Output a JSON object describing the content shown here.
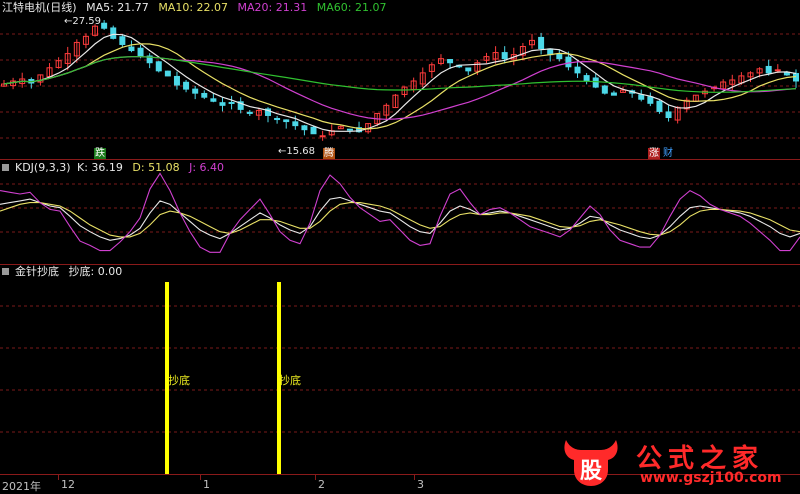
{
  "price_panel": {
    "title": "江特电机(日线)",
    "ma": [
      {
        "label": "MA5: 21.77",
        "color": "#e8e8e8"
      },
      {
        "label": "MA10: 22.07",
        "color": "#e8e066"
      },
      {
        "label": "MA20: 21.31",
        "color": "#d040d0"
      },
      {
        "label": "MA60: 21.07",
        "color": "#30c030"
      }
    ],
    "high_label": "27.59",
    "low_label": "15.68",
    "markers": [
      {
        "text": "跌",
        "bg": "#1a7a1a",
        "color": "#ffffff"
      },
      {
        "text": "腾",
        "bg": "#b05010",
        "color": "#ffffff"
      },
      {
        "text": "涨",
        "bg": "#b02020",
        "color": "#ffffff"
      },
      {
        "text": "财",
        "bg": "#000000",
        "color": "#40a0ff"
      }
    ]
  },
  "kdj_panel": {
    "name": "KDJ(9,3,3)",
    "k": "K: 36.19",
    "d": "D: 51.08",
    "j": "J: 6.40",
    "colors": {
      "k": "#e8e8e8",
      "d": "#e8e066",
      "j": "#d040d0"
    }
  },
  "signal_panel": {
    "name": "金针抄底",
    "value": "抄底: 0.00",
    "signal_label": "抄底",
    "signal_color": "#ffff00"
  },
  "time_axis": {
    "labels": [
      "2021年",
      "12",
      "1",
      "2",
      "3"
    ]
  },
  "watermark": {
    "title": "公式之家",
    "url": "www.gszj100.com",
    "logo_text": "股"
  },
  "chart_data": [
    {
      "type": "candlestick",
      "ylim": [
        15.68,
        27.59
      ],
      "annotations": [
        "27.59",
        "15.68"
      ],
      "close": [
        21.5,
        21.8,
        22.0,
        21.6,
        22.4,
        23.1,
        23.8,
        24.5,
        25.6,
        26.2,
        27.2,
        27.0,
        26.0,
        25.4,
        24.8,
        24.2,
        23.6,
        22.8,
        22.3,
        21.4,
        21.0,
        20.6,
        20.2,
        19.8,
        19.4,
        19.6,
        19.0,
        18.6,
        18.9,
        18.4,
        18.0,
        17.8,
        17.4,
        17.0,
        16.6,
        16.4,
        16.9,
        17.3,
        17.0,
        16.8,
        17.6,
        18.6,
        19.4,
        20.4,
        21.2,
        21.8,
        22.6,
        23.4,
        24.0,
        23.6,
        23.2,
        22.8,
        23.6,
        24.2,
        24.6,
        24.0,
        24.4,
        25.2,
        25.8,
        25.0,
        24.4,
        24.0,
        23.2,
        22.6,
        21.8,
        21.2,
        20.6,
        20.4,
        20.9,
        20.6,
        20.0,
        19.6,
        18.8,
        18.2,
        19.2,
        19.9,
        20.4,
        20.8,
        21.2,
        21.7,
        21.9,
        22.3,
        22.6,
        23.0,
        22.6,
        22.9,
        22.4,
        21.8
      ]
    },
    {
      "type": "line",
      "series": [
        {
          "name": "K",
          "values": [
            70,
            72,
            74,
            76,
            72,
            68,
            66,
            56,
            45,
            38,
            32,
            28,
            30,
            34,
            42,
            60,
            74,
            70,
            60,
            50,
            40,
            34,
            30,
            36,
            44,
            52,
            60,
            54,
            46,
            40,
            36,
            44,
            62,
            76,
            78,
            74,
            70,
            66,
            62,
            60,
            52,
            44,
            38,
            36,
            48,
            62,
            68,
            64,
            58,
            60,
            62,
            60,
            56,
            52,
            48,
            44,
            40,
            42,
            48,
            56,
            54,
            46,
            40,
            36,
            32,
            30,
            34,
            44,
            56,
            66,
            68,
            66,
            64,
            62,
            60,
            56,
            50,
            44,
            36,
            32,
            36
          ]
        },
        {
          "name": "D",
          "values": [
            62,
            66,
            70,
            72,
            72,
            70,
            68,
            62,
            54,
            46,
            40,
            34,
            32,
            32,
            36,
            46,
            58,
            62,
            60,
            56,
            50,
            44,
            38,
            36,
            40,
            46,
            52,
            52,
            50,
            46,
            42,
            42,
            50,
            62,
            70,
            72,
            72,
            70,
            68,
            64,
            58,
            52,
            46,
            42,
            44,
            52,
            58,
            60,
            58,
            58,
            60,
            60,
            58,
            56,
            52,
            48,
            44,
            43,
            45,
            50,
            52,
            49,
            46,
            42,
            38,
            35,
            34,
            38,
            46,
            56,
            62,
            64,
            64,
            63,
            62,
            60,
            56,
            52,
            46,
            40,
            38
          ]
        },
        {
          "name": "J",
          "values": [
            86,
            84,
            82,
            84,
            72,
            64,
            62,
            44,
            27,
            22,
            16,
            16,
            26,
            38,
            54,
            88,
            106,
            86,
            60,
            38,
            20,
            14,
            14,
            36,
            52,
            64,
            76,
            58,
            38,
            28,
            24,
            48,
            86,
            104,
            94,
            78,
            66,
            58,
            50,
            52,
            40,
            28,
            22,
            24,
            56,
            82,
            88,
            72,
            58,
            64,
            66,
            60,
            52,
            44,
            40,
            36,
            32,
            40,
            54,
            68,
            58,
            40,
            28,
            24,
            20,
            20,
            34,
            56,
            76,
            86,
            80,
            70,
            64,
            60,
            56,
            48,
            38,
            28,
            16,
            16,
            32
          ]
        }
      ]
    }
  ]
}
